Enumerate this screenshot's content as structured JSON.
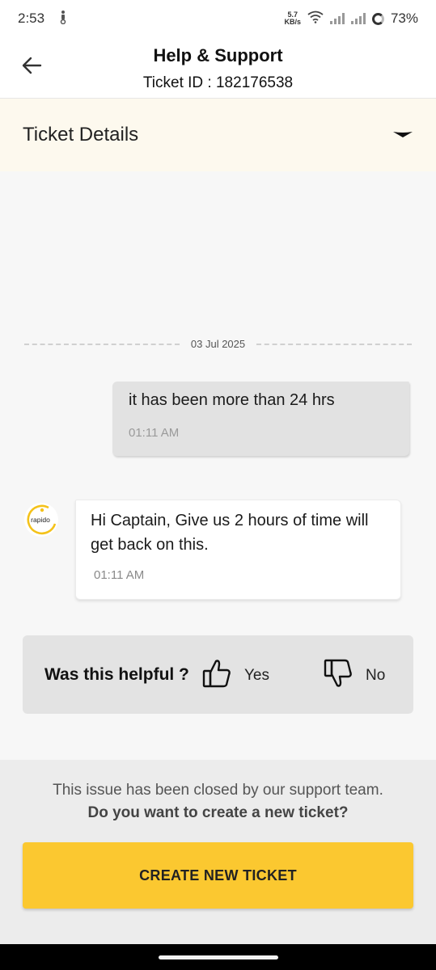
{
  "status_bar": {
    "time": "2:53",
    "net_speed_value": "5.7",
    "net_speed_unit": "KB/s",
    "battery": "73%",
    "icons": [
      "scooter-icon",
      "wifi-icon",
      "signal-icon",
      "signal-icon",
      "battery-ring-icon"
    ]
  },
  "header": {
    "title": "Help & Support",
    "subtitle": "Ticket ID : 182176538",
    "back_icon": "arrow-left-icon"
  },
  "ticket_details": {
    "label": "Ticket Details",
    "toggle_icon": "caret-down-icon"
  },
  "chat": {
    "date": "03 Jul 2025",
    "messages": [
      {
        "from": "user",
        "text": "it has been more than 24 hrs",
        "time": "01:11 AM"
      },
      {
        "from": "support",
        "avatar": "rapido",
        "text": "Hi Captain, Give us 2 hours of time will get back on this.",
        "time": "01:11 AM"
      }
    ]
  },
  "feedback": {
    "question": "Was this helpful ?",
    "yes_label": "Yes",
    "no_label": "No",
    "yes_icon": "thumbs-up-icon",
    "no_icon": "thumbs-down-icon"
  },
  "footer": {
    "closed_note": "This issue has been closed by our support team.",
    "closed_question": "Do you want to create a new ticket?",
    "button_label": "CREATE NEW TICKET",
    "button_color": "#fbc830"
  },
  "colors": {
    "accent": "#fbc830",
    "ticket_details_bg": "#fdf9ee"
  }
}
